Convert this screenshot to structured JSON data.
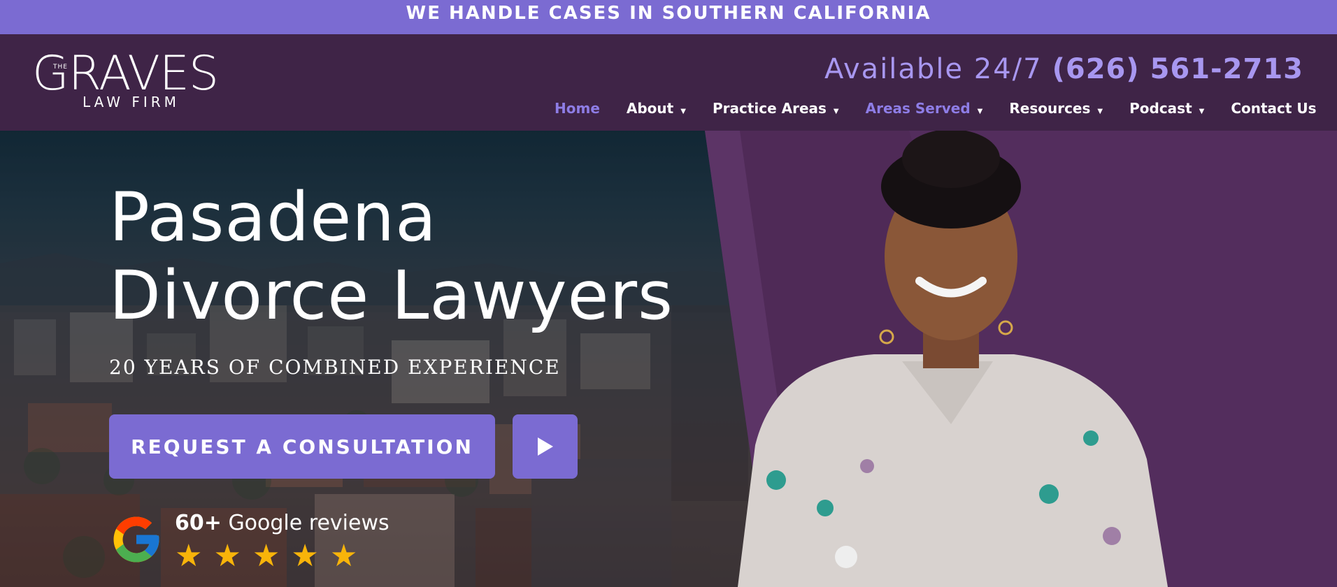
{
  "topbar": {
    "text": "WE HANDLE CASES IN SOUTHERN CALIFORNIA"
  },
  "logo": {
    "the": "THE",
    "name": "GRAVES",
    "sub": "LAW FIRM"
  },
  "contact": {
    "label": "Available 24/7",
    "phone": "(626) 561-2713"
  },
  "nav": {
    "items": [
      {
        "label": "Home",
        "dropdown": false
      },
      {
        "label": "About",
        "dropdown": true
      },
      {
        "label": "Practice Areas",
        "dropdown": true
      },
      {
        "label": "Areas Served",
        "dropdown": true
      },
      {
        "label": "Resources",
        "dropdown": true
      },
      {
        "label": "Podcast",
        "dropdown": true
      },
      {
        "label": "Contact Us",
        "dropdown": false
      }
    ],
    "caret": "▼"
  },
  "hero": {
    "title_line1": "Pasadena",
    "title_line2": "Divorce Lawyers",
    "subtitle": "20 YEARS OF COMBINED EXPERIENCE",
    "cta_label": "REQUEST A CONSULTATION",
    "play_icon": "play-icon"
  },
  "reviews": {
    "count": "60+",
    "label": "Google reviews",
    "rating": 5,
    "star": "★"
  },
  "colors": {
    "accent": "#7b6bd2",
    "header_bg": "#3f2447",
    "hero_purple": "#4f2a57",
    "nav_active": "#8e7de6",
    "phone": "#a897f0",
    "star": "#f8b40a"
  }
}
